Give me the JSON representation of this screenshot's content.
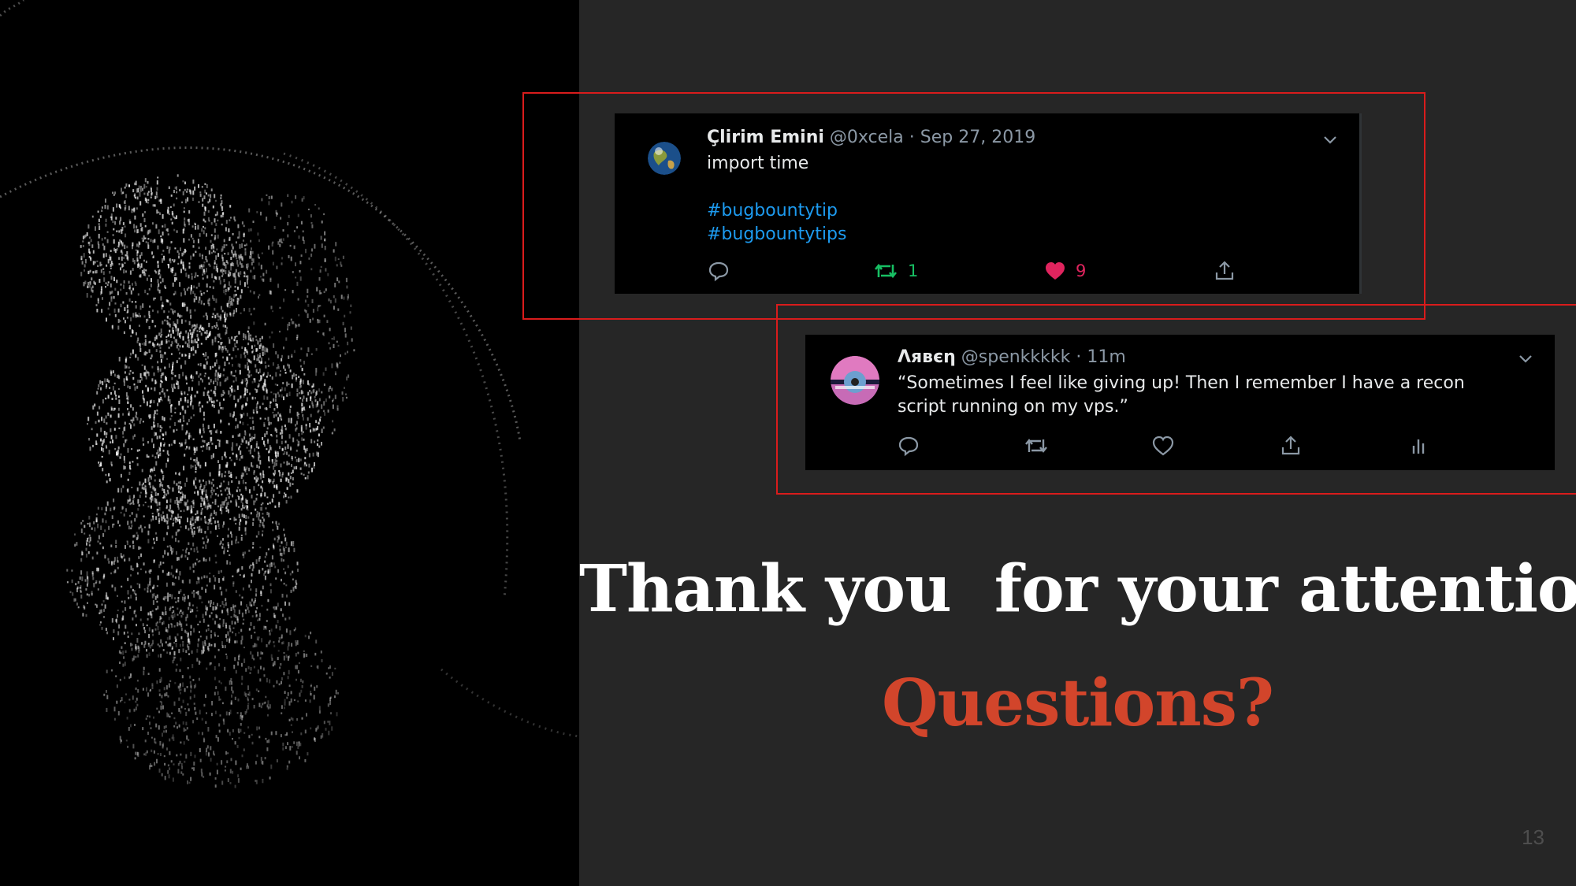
{
  "colors": {
    "slide_background": "#262626",
    "highlight": "#d91c1c",
    "title": "#ffffff",
    "accent": "#d2452b",
    "hashtag": "#1d9bf0",
    "retweet_active": "#17bf63",
    "like_active": "#e0245e"
  },
  "tweet1": {
    "name": "Çlirim Emini",
    "handle": "@0xcela",
    "separator": "·",
    "date": "Sep 27, 2019",
    "text": "import time",
    "hashtags": [
      "#bugbountytip",
      "#bugbountytips"
    ],
    "retweets": "1",
    "likes": "9",
    "icons": [
      "reply-icon",
      "retweet-icon",
      "heart-filled-icon",
      "share-icon",
      "chevron-down-icon"
    ]
  },
  "tweet2": {
    "name": "Λявєη",
    "handle": "@spenkkkkk",
    "separator": "·",
    "date": "11m",
    "text": "“Sometimes I feel like giving up! Then I remember I have a recon script running on my vps.”",
    "icons": [
      "reply-icon",
      "retweet-icon",
      "heart-icon",
      "share-icon",
      "analytics-icon",
      "chevron-down-icon"
    ]
  },
  "slide": {
    "title": "Thank you  for your attention",
    "subtitle": "Questions?",
    "page_number": "13"
  }
}
